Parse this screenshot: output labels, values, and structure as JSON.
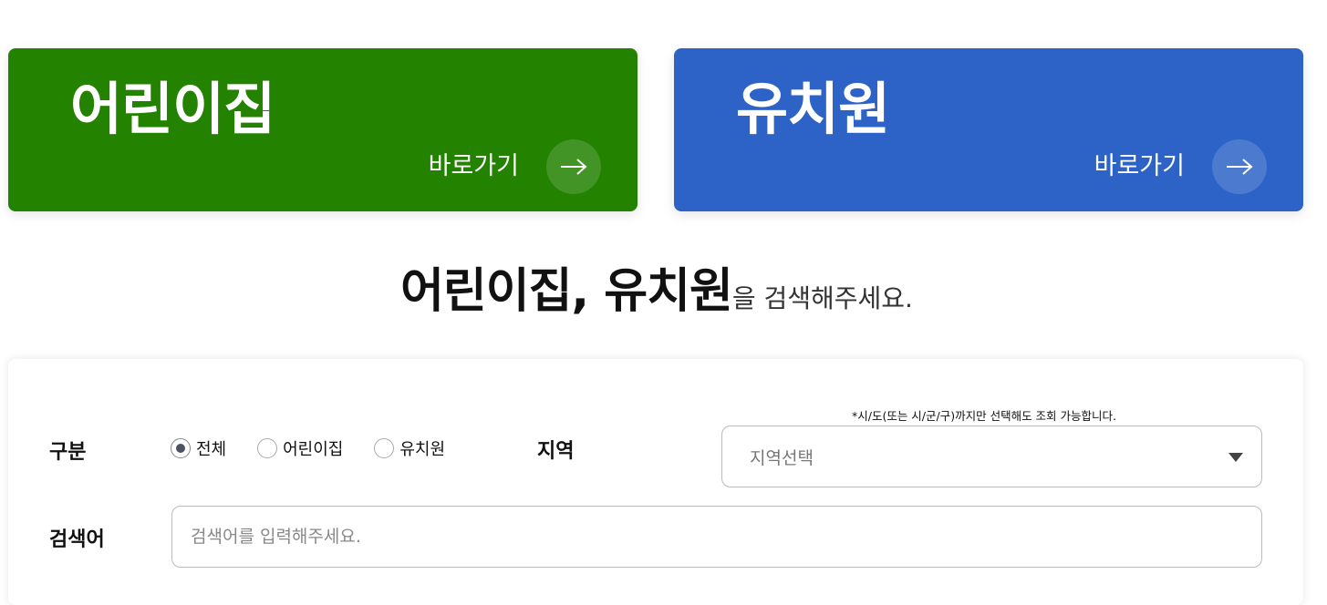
{
  "cards": {
    "daycare": {
      "title": "어린이집",
      "link_label": "바로가기",
      "color": "#238200"
    },
    "kindergarten": {
      "title": "유치원",
      "link_label": "바로가기",
      "color": "#2d63c7"
    }
  },
  "headline": {
    "strong": "어린이집, 유치원",
    "light": "을 검색해주세요."
  },
  "search_form": {
    "category_label": "구분",
    "category_options": [
      {
        "label": "전체",
        "selected": true
      },
      {
        "label": "어린이집",
        "selected": false
      },
      {
        "label": "유치원",
        "selected": false
      }
    ],
    "region_label": "지역",
    "region_hint": "*시/도(또는 시/군/구)까지만 선택해도 조회 가능합니다.",
    "region_select_value": "지역선택",
    "keyword_label": "검색어",
    "keyword_placeholder": "검색어를 입력해주세요."
  }
}
